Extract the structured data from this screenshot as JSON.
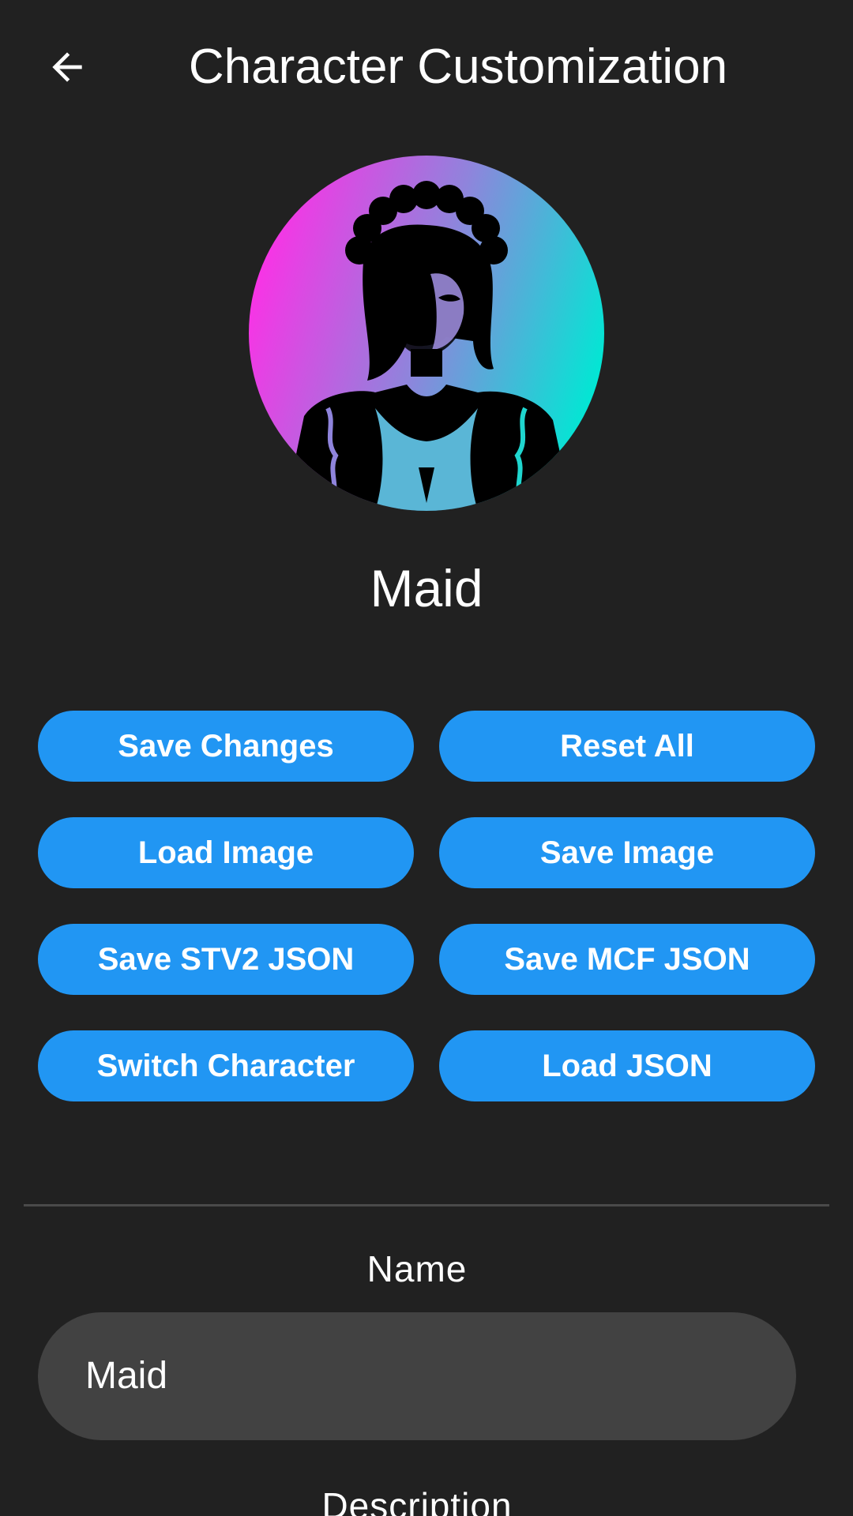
{
  "appbar": {
    "title": "Character Customization",
    "back_icon": "arrow-left-icon"
  },
  "character": {
    "display_name": "Maid",
    "avatar_gradient": [
      "#ff2ee6",
      "#00e8d4"
    ]
  },
  "actions": [
    {
      "id": "save-changes-button",
      "label": "Save Changes"
    },
    {
      "id": "reset-all-button",
      "label": "Reset All"
    },
    {
      "id": "load-image-button",
      "label": "Load Image"
    },
    {
      "id": "save-image-button",
      "label": "Save Image"
    },
    {
      "id": "save-stv2-json-button",
      "label": "Save STV2 JSON"
    },
    {
      "id": "save-mcf-json-button",
      "label": "Save MCF JSON"
    },
    {
      "id": "switch-character-button",
      "label": "Switch Character"
    },
    {
      "id": "load-json-button",
      "label": "Load JSON"
    }
  ],
  "form": {
    "name_label": "Name",
    "name_value": "Maid",
    "description_label": "Description"
  },
  "colors": {
    "background": "#212121",
    "accent": "#2196f3",
    "input_bg": "#424242"
  }
}
